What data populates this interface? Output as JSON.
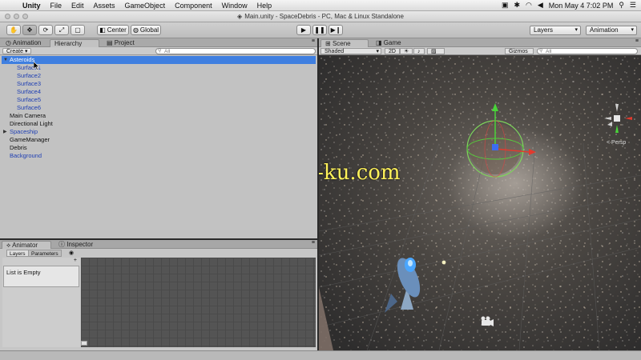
{
  "menubar": {
    "app": "Unity",
    "items": [
      "File",
      "Edit",
      "Assets",
      "GameObject",
      "Component",
      "Window",
      "Help"
    ],
    "clock": "Mon May 4  7:02 PM"
  },
  "window": {
    "title": "Main.unity - SpaceDebris - PC, Mac & Linux Standalone"
  },
  "toolbar": {
    "pivot_label": "Center",
    "space_label": "Global",
    "layers_label": "Layers",
    "layout_label": "Animation"
  },
  "hierarchy": {
    "tabs": [
      "Animation",
      "Hierarchy",
      "Project"
    ],
    "create_label": "Create",
    "search_placeholder": "All",
    "items": [
      {
        "label": "Asteroids"
      },
      {
        "label": "Surface1"
      },
      {
        "label": "Surface2"
      },
      {
        "label": "Surface3"
      },
      {
        "label": "Surface4"
      },
      {
        "label": "Surface5"
      },
      {
        "label": "Surface6"
      },
      {
        "label": "Main Camera"
      },
      {
        "label": "Directional Light"
      },
      {
        "label": "Spaceship"
      },
      {
        "label": "GameManager"
      },
      {
        "label": "Debris"
      },
      {
        "label": "Background"
      }
    ]
  },
  "animator": {
    "tabs": [
      "Animator",
      "Inspector"
    ],
    "subtabs": [
      "Layers",
      "Parameters"
    ],
    "empty_text": "List is Empty"
  },
  "scene": {
    "tabs": [
      "Scene",
      "Game"
    ],
    "shading": "Shaded",
    "mode_2d": "2D",
    "gizmos_label": "Gizmos",
    "gizmo_search": "All",
    "persp_label": "< Persp",
    "watermark": "www.cg-ku.com"
  },
  "colors": {
    "selection": "#3f7fe0",
    "prefab_text": "#1f3fb3",
    "watermark": "#fff25a"
  }
}
